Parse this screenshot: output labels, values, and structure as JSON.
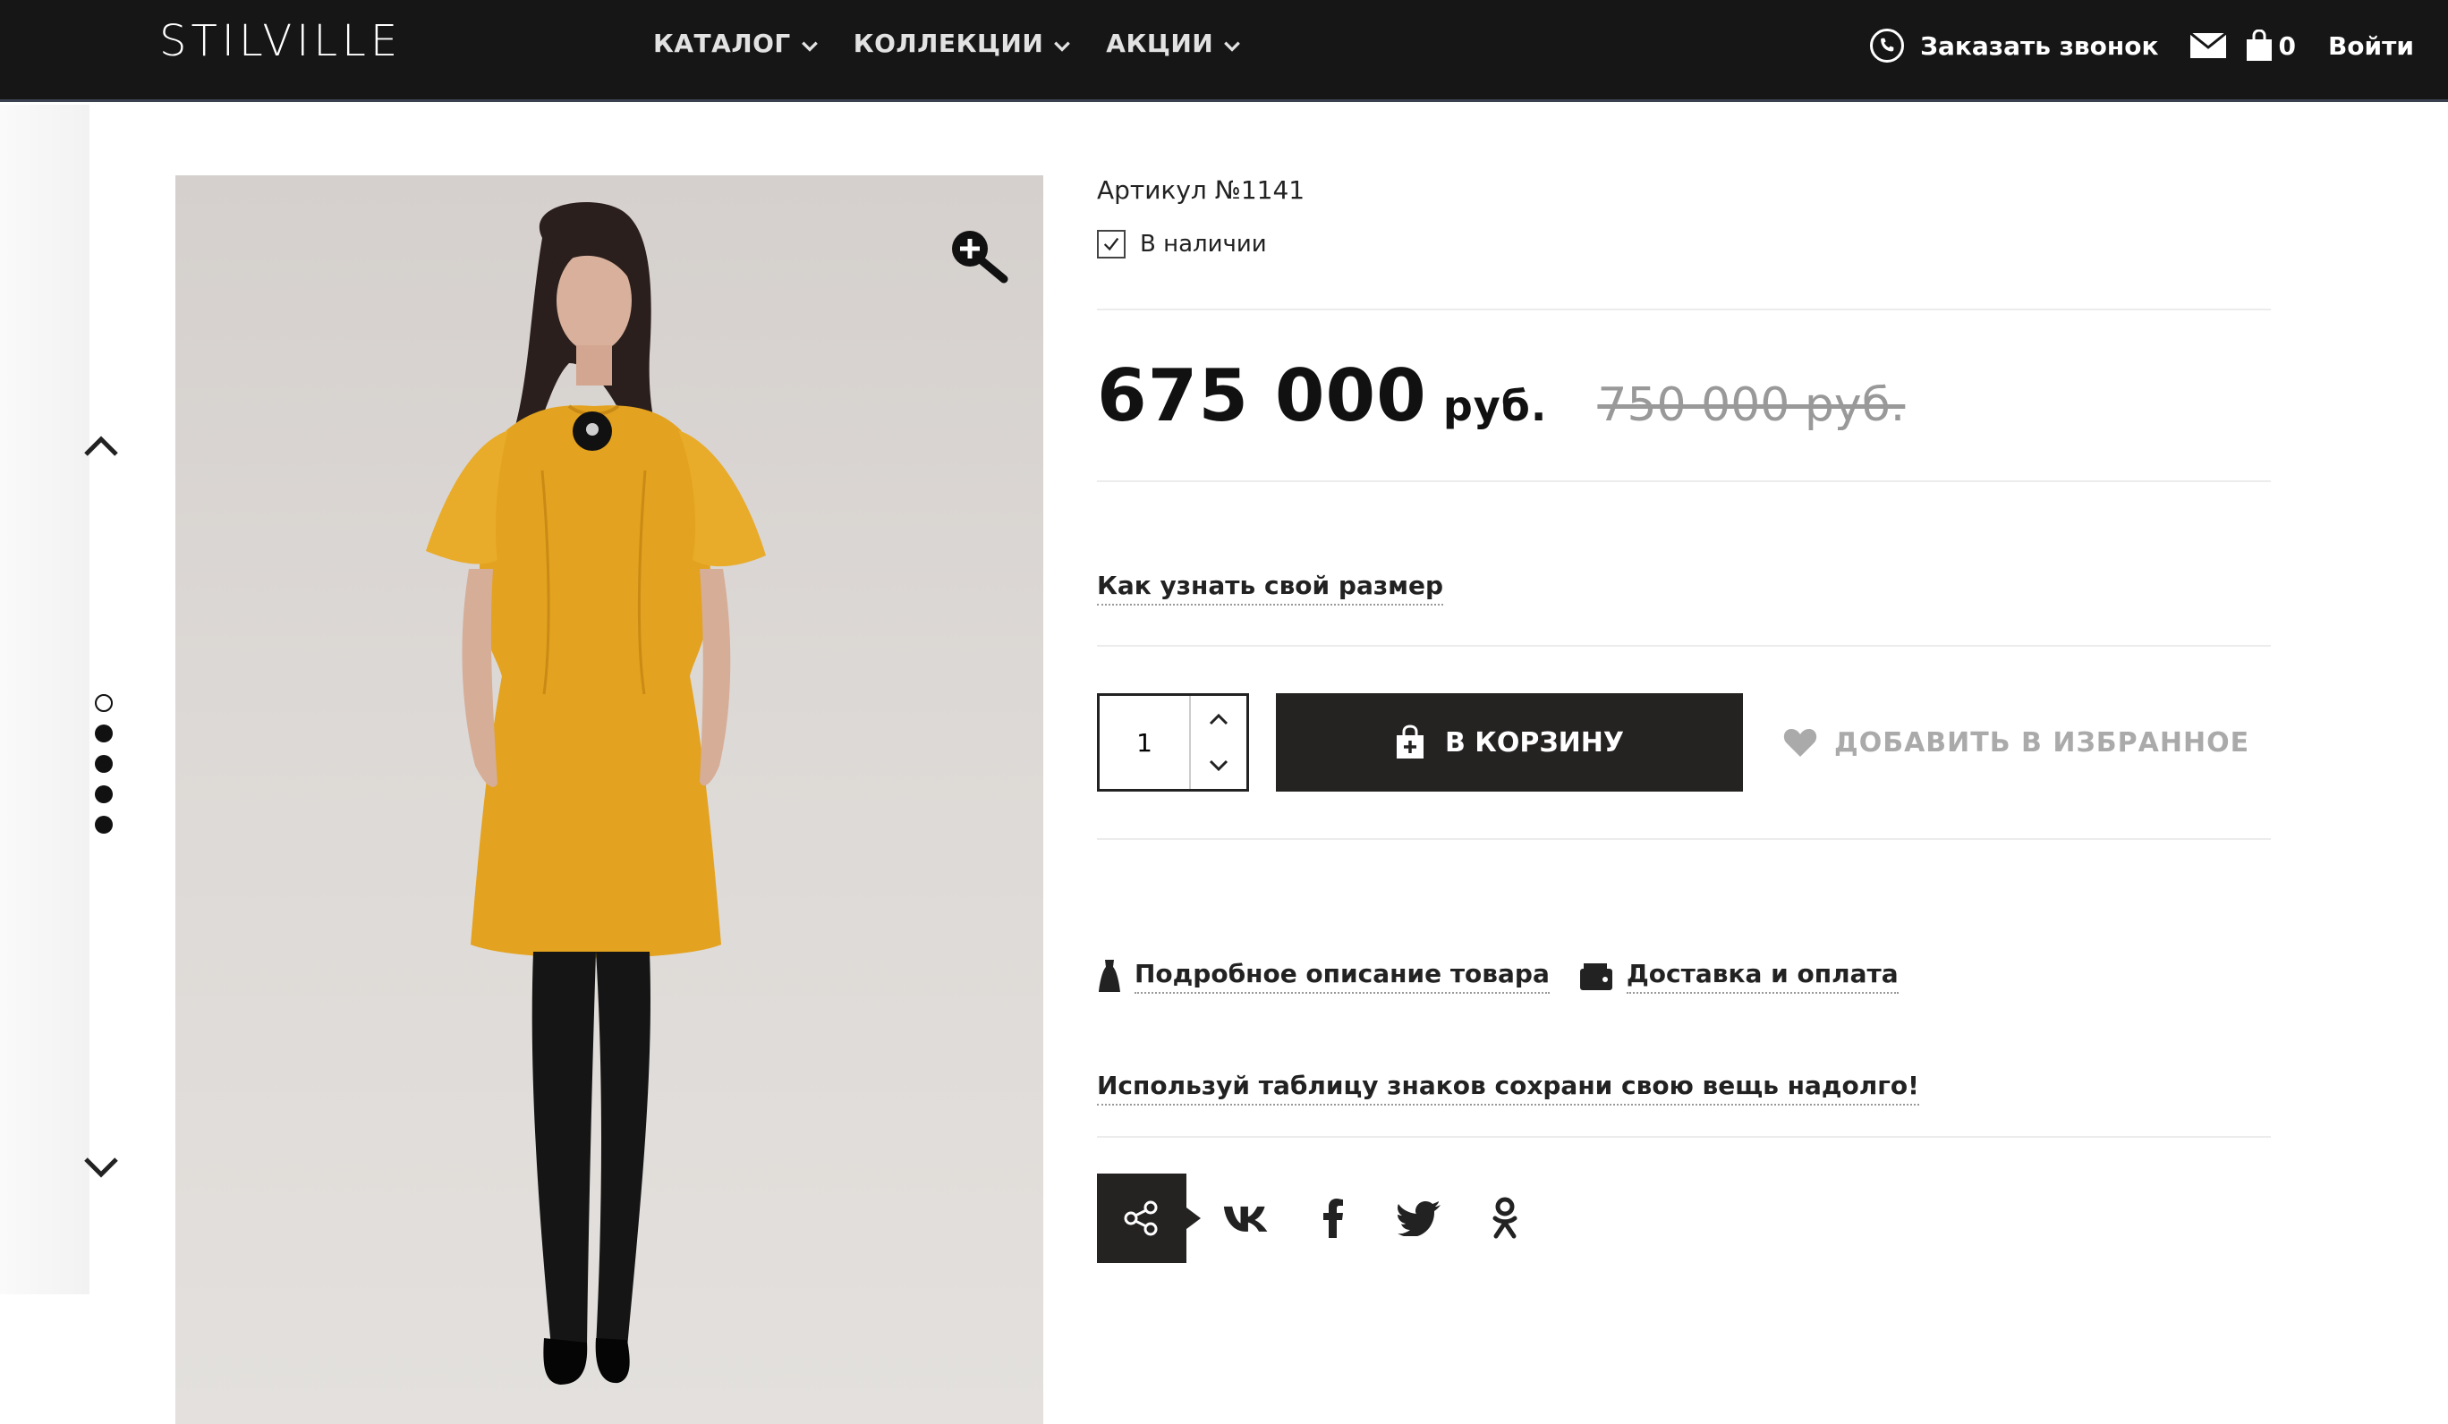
{
  "header": {
    "logo": "STILVILLE",
    "nav": [
      {
        "label": "КАТАЛОГ"
      },
      {
        "label": "КОЛЛЕКЦИИ"
      },
      {
        "label": "АКЦИИ"
      }
    ],
    "callback_label": "Заказать звонок",
    "cart_count": "0",
    "login_label": "Войти"
  },
  "gallery": {
    "slide_count": 5,
    "active_slide": 1
  },
  "product": {
    "article": "Артикул №1141",
    "stock_label": "В наличии",
    "price": "675 000",
    "price_currency": "руб.",
    "old_price": "750 000 руб.",
    "size_link": "Как узнать свой размер",
    "quantity": "1",
    "add_to_cart_label": "В КОРЗИНУ",
    "favorite_label": "ДОБАВИТЬ В ИЗБРАННОЕ",
    "description_link": "Подробное описание товара",
    "delivery_link": "Доставка и оплата",
    "care_link": "Используй таблицу знаков сохрани свою вещь надолго!"
  },
  "colors": {
    "header_bg": "#161616",
    "dress": "#e3a21f",
    "button_dark": "#252222"
  }
}
